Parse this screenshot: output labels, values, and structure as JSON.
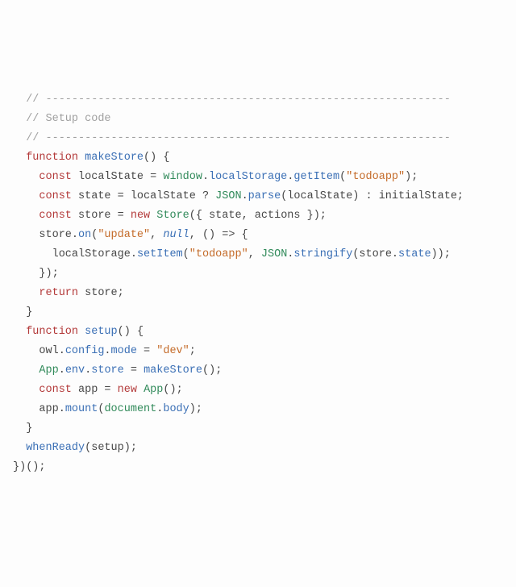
{
  "tokens": [
    [
      [
        "sp",
        "  "
      ],
      [
        "c",
        "// --------------------------------------------------------------"
      ]
    ],
    [
      [
        "sp",
        "  "
      ],
      [
        "c",
        "// Setup code"
      ]
    ],
    [
      [
        "sp",
        "  "
      ],
      [
        "c",
        "// --------------------------------------------------------------"
      ]
    ],
    [
      [
        "sp",
        "  "
      ],
      [
        "kw",
        "function"
      ],
      [
        "p",
        " "
      ],
      [
        "fn",
        "makeStore"
      ],
      [
        "p",
        "() {"
      ]
    ],
    [
      [
        "sp",
        "    "
      ],
      [
        "kw",
        "const"
      ],
      [
        "p",
        " localState = "
      ],
      [
        "cl",
        "window"
      ],
      [
        "p",
        "."
      ],
      [
        "pr",
        "localStorage"
      ],
      [
        "p",
        "."
      ],
      [
        "fn",
        "getItem"
      ],
      [
        "p",
        "("
      ],
      [
        "st",
        "\"todoapp\""
      ],
      [
        "p",
        ");"
      ]
    ],
    [
      [
        "sp",
        "    "
      ],
      [
        "kw",
        "const"
      ],
      [
        "p",
        " state = localState ? "
      ],
      [
        "cl",
        "JSON"
      ],
      [
        "p",
        "."
      ],
      [
        "fn",
        "parse"
      ],
      [
        "p",
        "(localState) : initialState;"
      ]
    ],
    [
      [
        "sp",
        "    "
      ],
      [
        "kw",
        "const"
      ],
      [
        "p",
        " store = "
      ],
      [
        "kw",
        "new"
      ],
      [
        "p",
        " "
      ],
      [
        "cl",
        "Store"
      ],
      [
        "p",
        "({ state, actions });"
      ]
    ],
    [
      [
        "sp",
        "    "
      ],
      [
        "p",
        "store."
      ],
      [
        "fn",
        "on"
      ],
      [
        "p",
        "("
      ],
      [
        "st",
        "\"update\""
      ],
      [
        "p",
        ", "
      ],
      [
        "lt",
        "null"
      ],
      [
        "p",
        ", () => {"
      ]
    ],
    [
      [
        "sp",
        "      "
      ],
      [
        "p",
        "localStorage."
      ],
      [
        "fn",
        "setItem"
      ],
      [
        "p",
        "("
      ],
      [
        "st",
        "\"todoapp\""
      ],
      [
        "p",
        ", "
      ],
      [
        "cl",
        "JSON"
      ],
      [
        "p",
        "."
      ],
      [
        "fn",
        "stringify"
      ],
      [
        "p",
        "(store."
      ],
      [
        "pr",
        "state"
      ],
      [
        "p",
        "));"
      ]
    ],
    [
      [
        "sp",
        "    "
      ],
      [
        "p",
        "});"
      ]
    ],
    [
      [
        "sp",
        "    "
      ],
      [
        "kw",
        "return"
      ],
      [
        "p",
        " store;"
      ]
    ],
    [
      [
        "sp",
        "  "
      ],
      [
        "p",
        "}"
      ]
    ],
    [
      [
        "p",
        ""
      ]
    ],
    [
      [
        "sp",
        "  "
      ],
      [
        "kw",
        "function"
      ],
      [
        "p",
        " "
      ],
      [
        "fn",
        "setup"
      ],
      [
        "p",
        "() {"
      ]
    ],
    [
      [
        "sp",
        "    "
      ],
      [
        "p",
        "owl."
      ],
      [
        "pr",
        "config"
      ],
      [
        "p",
        "."
      ],
      [
        "pr",
        "mode"
      ],
      [
        "p",
        " = "
      ],
      [
        "st",
        "\"dev\""
      ],
      [
        "p",
        ";"
      ]
    ],
    [
      [
        "sp",
        "    "
      ],
      [
        "cl",
        "App"
      ],
      [
        "p",
        "."
      ],
      [
        "pr",
        "env"
      ],
      [
        "p",
        "."
      ],
      [
        "pr",
        "store"
      ],
      [
        "p",
        " = "
      ],
      [
        "fn",
        "makeStore"
      ],
      [
        "p",
        "();"
      ]
    ],
    [
      [
        "sp",
        "    "
      ],
      [
        "kw",
        "const"
      ],
      [
        "p",
        " app = "
      ],
      [
        "kw",
        "new"
      ],
      [
        "p",
        " "
      ],
      [
        "cl",
        "App"
      ],
      [
        "p",
        "();"
      ]
    ],
    [
      [
        "sp",
        "    "
      ],
      [
        "p",
        "app."
      ],
      [
        "fn",
        "mount"
      ],
      [
        "p",
        "("
      ],
      [
        "cl",
        "document"
      ],
      [
        "p",
        "."
      ],
      [
        "pr",
        "body"
      ],
      [
        "p",
        ");"
      ]
    ],
    [
      [
        "sp",
        "  "
      ],
      [
        "p",
        "}"
      ]
    ],
    [
      [
        "p",
        ""
      ]
    ],
    [
      [
        "sp",
        "  "
      ],
      [
        "fn",
        "whenReady"
      ],
      [
        "p",
        "(setup);"
      ]
    ],
    [
      [
        "p",
        "})();"
      ]
    ]
  ]
}
